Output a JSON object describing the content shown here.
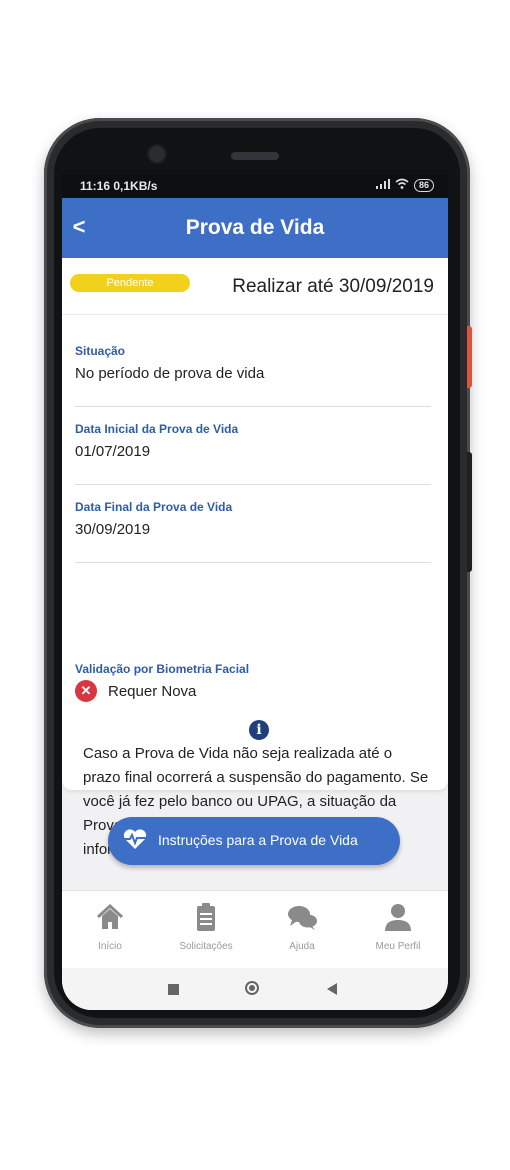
{
  "status_bar": {
    "time": "11:16",
    "speed": "0,1KB/s",
    "battery": "86"
  },
  "header": {
    "back_label": "<",
    "title": "Prova de Vida"
  },
  "status": {
    "badge": "Pendente",
    "deadline": "Realizar até 30/09/2019"
  },
  "fields": [
    {
      "label": "Situação",
      "value": "No período de prova de vida"
    },
    {
      "label": "Data Inicial da Prova de Vida",
      "value": "01/07/2019"
    },
    {
      "label": "Data Final da Prova de Vida",
      "value": "30/09/2019"
    }
  ],
  "biometry": {
    "label": "Validação por Biometria Facial",
    "value": "Requer Nova",
    "icon": "error-x-icon"
  },
  "notice": {
    "icon": "info-icon",
    "text": "Caso a Prova de Vida não seja realizada até o prazo final ocorrerá a suspensão do pagamento. Se você já fez pelo banco ou UPAG, a situação da Prova de Vida será atualizada assim que a informação for confirmada no sistema."
  },
  "cta": {
    "label": "Instruções para a Prova de Vida",
    "icon": "heart-pulse-icon"
  },
  "tabs": [
    {
      "label": "Início",
      "icon": "home-icon"
    },
    {
      "label": "Solicitações",
      "icon": "clipboard-icon"
    },
    {
      "label": "Ajuda",
      "icon": "chat-icon"
    },
    {
      "label": "Meu Perfil",
      "icon": "user-icon"
    }
  ],
  "colors": {
    "primary": "#3d6fc6",
    "badge": "#f2d11c",
    "label": "#2f5ca8",
    "error": "#d7373f"
  }
}
